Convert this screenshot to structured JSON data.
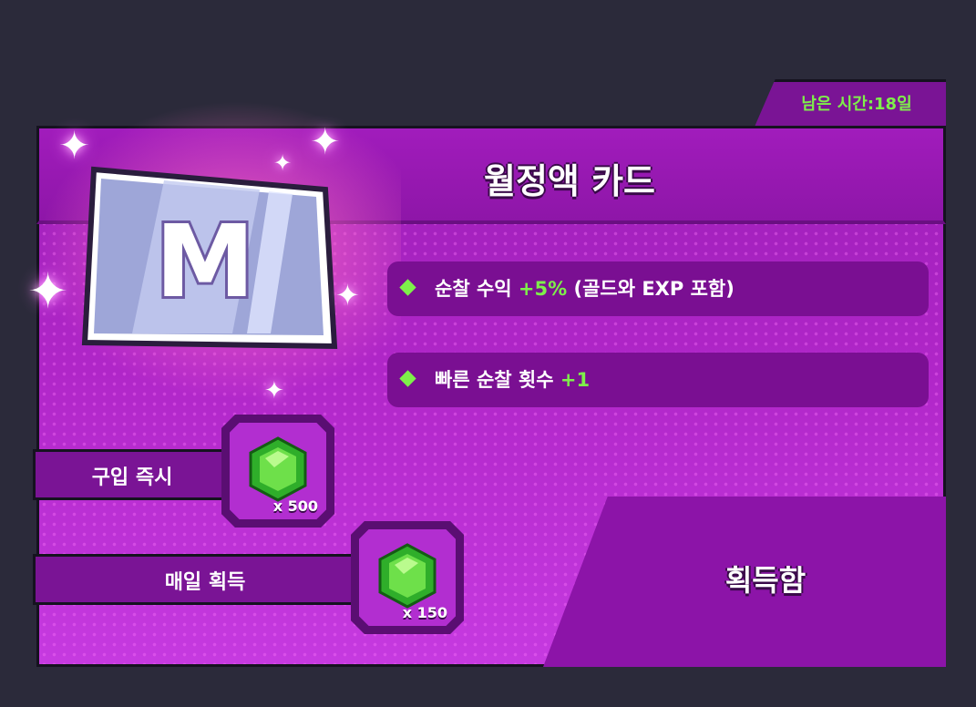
{
  "timer": {
    "text": "남은 시간:18일"
  },
  "card": {
    "title": "월정액 카드",
    "emblem_letter": "M",
    "benefits": [
      {
        "prefix": "순찰 수익 ",
        "highlight": "+5%",
        "suffix": " (골드와 EXP 포함)"
      },
      {
        "prefix": "빠른 순찰 횟수 ",
        "highlight": "+1",
        "suffix": ""
      }
    ]
  },
  "rewards": {
    "instant": {
      "label": "구입 즉시",
      "quantity": "x 500",
      "icon": "green-gem-icon"
    },
    "daily": {
      "label": "매일 획득",
      "quantity": "x 150",
      "icon": "green-gem-icon"
    }
  },
  "claim": {
    "label": "획득함"
  },
  "colors": {
    "accent_green": "#7ef04a",
    "panel_purple": "#b026c8",
    "dark_purple": "#7a1495"
  }
}
